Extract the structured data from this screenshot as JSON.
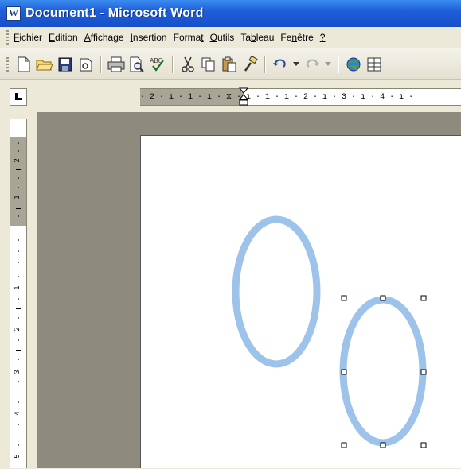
{
  "window": {
    "title": "Document1 - Microsoft Word"
  },
  "menubar": {
    "items": [
      {
        "mnemonic": "F",
        "rest": "ichier"
      },
      {
        "mnemonic": "E",
        "rest": "dition"
      },
      {
        "mnemonic": "A",
        "rest": "ffichage"
      },
      {
        "mnemonic": "I",
        "rest": "nsertion"
      },
      {
        "pre": "Forma",
        "mnemonic": "t",
        "rest": ""
      },
      {
        "mnemonic": "O",
        "rest": "utils"
      },
      {
        "pre": "Ta",
        "mnemonic": "b",
        "rest": "leau"
      },
      {
        "pre": "Fe",
        "mnemonic": "n",
        "rest": "être"
      },
      {
        "mnemonic": "?",
        "rest": ""
      }
    ]
  },
  "toolbar": {
    "buttons": [
      "new-document-icon",
      "open-folder-icon",
      "save-icon",
      "permission-icon",
      "print-icon",
      "print-preview-icon",
      "spelling-icon",
      "cut-icon",
      "copy-icon",
      "paste-icon",
      "format-painter-icon",
      "undo-icon",
      "redo-icon",
      "hyperlink-icon",
      "tables-borders-icon"
    ]
  },
  "ruler": {
    "horizontal_text": "· 2 · ı · 1 · ı · ⧖ · ı · 1 · ı · 2 · ı · 3 · ı · 4 · ı ·",
    "vertical_labels": [
      "2",
      "1",
      "1",
      "2",
      "3",
      "4",
      "5"
    ]
  },
  "colors": {
    "shape_outline": "#9dc3ea",
    "handle": "#000000"
  }
}
